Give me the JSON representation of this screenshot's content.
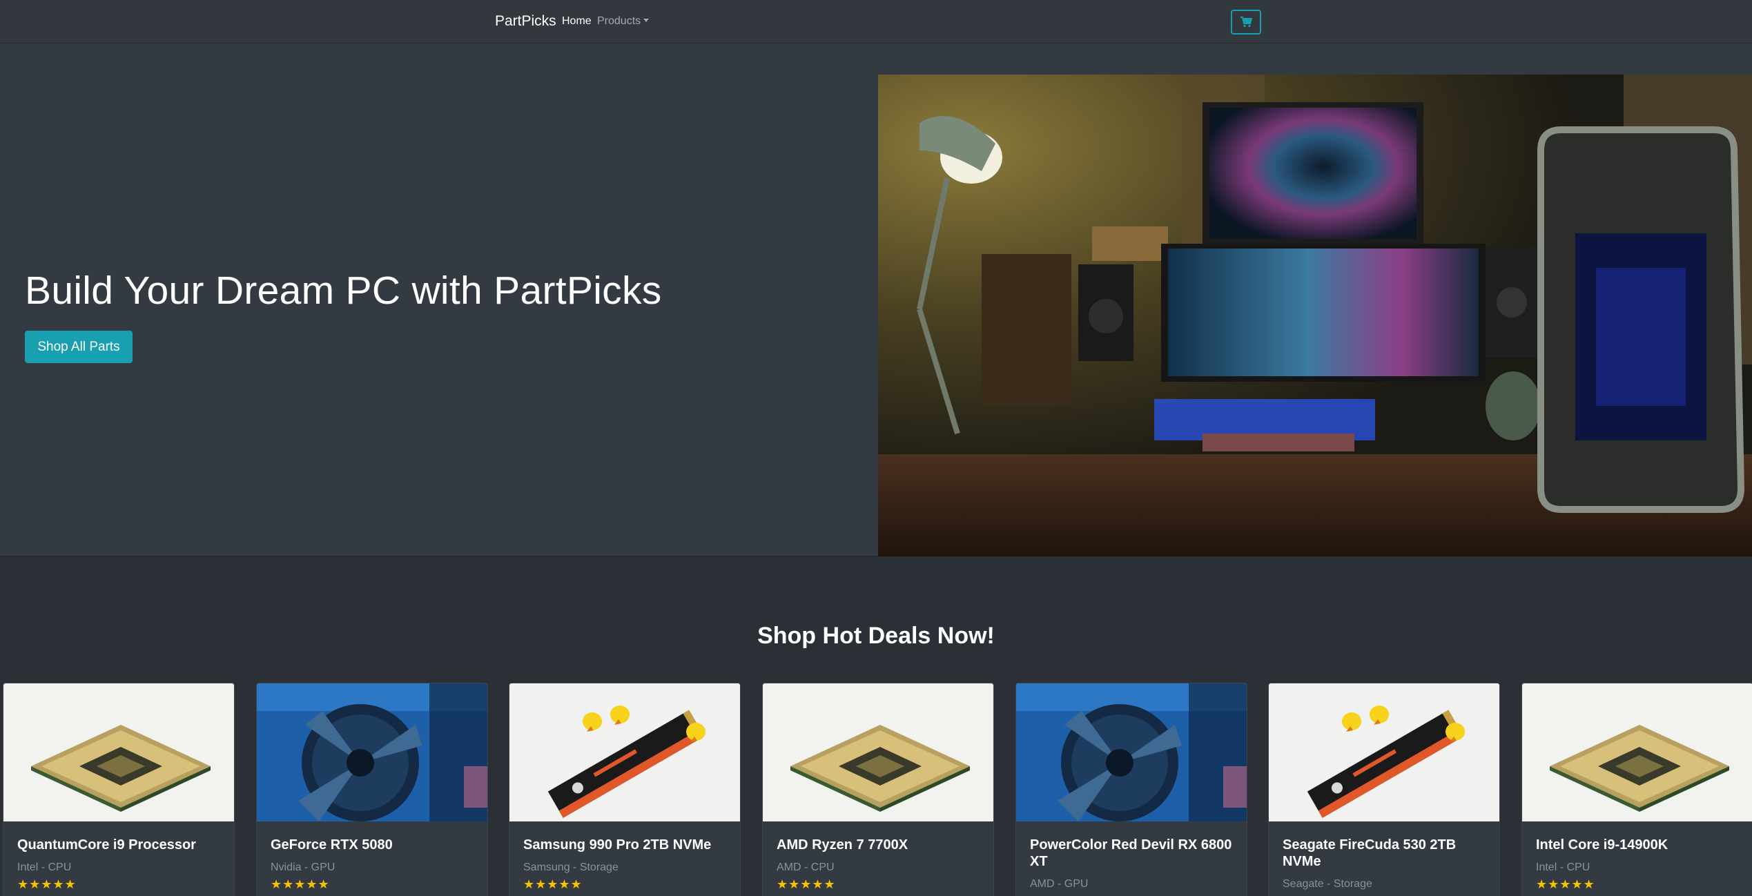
{
  "navbar": {
    "brand": "PartPicks",
    "home_label": "Home",
    "products_label": "Products",
    "cart_icon": "cart-icon"
  },
  "hero": {
    "title": "Build Your Dream PC with PartPicks",
    "button_label": "Shop All Parts",
    "image": "pc-desk-setup-photo"
  },
  "deals": {
    "title": "Shop Hot Deals Now!",
    "products": [
      {
        "name": "QuantumCore i9 Processor",
        "meta": "Intel - CPU",
        "image": "cpu-chip",
        "stars": "★★★★★"
      },
      {
        "name": "GeForce RTX 5080",
        "meta": "Nvidia - GPU",
        "image": "gpu-fan",
        "stars": "★★★★★"
      },
      {
        "name": "Samsung 990 Pro 2TB NVMe",
        "meta": "Samsung - Storage",
        "image": "nvme-ssd",
        "stars": "★★★★★"
      },
      {
        "name": "AMD Ryzen 7 7700X",
        "meta": "AMD - CPU",
        "image": "cpu-chip",
        "stars": "★★★★★"
      },
      {
        "name": "PowerColor Red Devil RX 6800 XT",
        "meta": "AMD - GPU",
        "image": "gpu-fan",
        "stars": "★★★★★"
      },
      {
        "name": "Seagate FireCuda 530 2TB NVMe",
        "meta": "Seagate - Storage",
        "image": "nvme-ssd",
        "stars": "★★★★★"
      },
      {
        "name": "Intel Core i9-14900K",
        "meta": "Intel - CPU",
        "image": "cpu-chip",
        "stars": "★★★★★"
      }
    ]
  },
  "colors": {
    "accent": "#18a0b0",
    "background": "#2b3036",
    "navbar": "#32383e",
    "card": "#343a41",
    "stars": "#f5c400"
  }
}
